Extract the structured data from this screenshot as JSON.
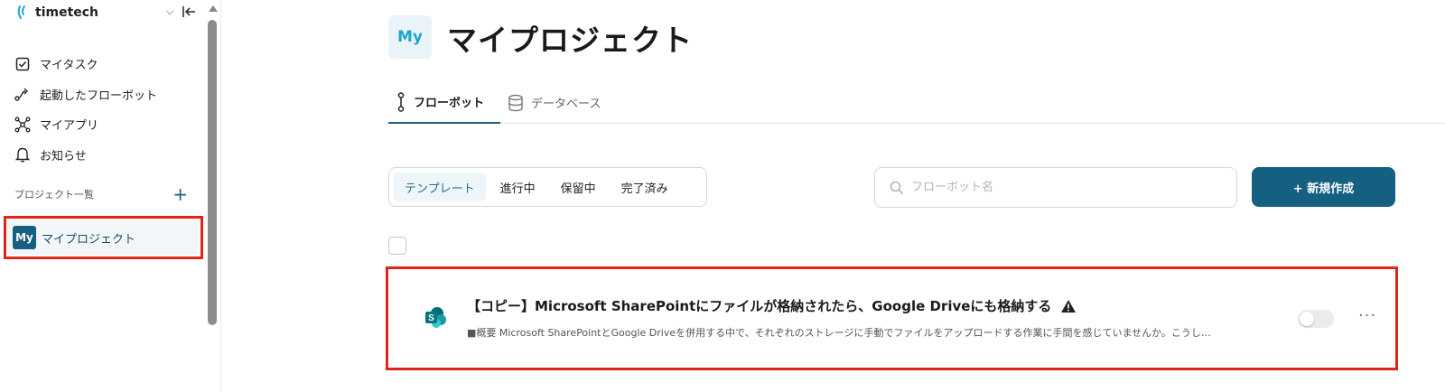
{
  "workspace": {
    "name": "timetech"
  },
  "sidebar": {
    "items": [
      {
        "label": "マイタスク",
        "icon": "checkbox-icon"
      },
      {
        "label": "起動したフローボット",
        "icon": "flow-icon"
      },
      {
        "label": "マイアプリ",
        "icon": "apps-icon"
      },
      {
        "label": "お知らせ",
        "icon": "bell-icon"
      }
    ],
    "projects_heading": "プロジェクト一覧",
    "add_label": "+",
    "project": {
      "badge": "My",
      "label": "マイプロジェクト"
    }
  },
  "page": {
    "badge": "My",
    "title": "マイプロジェクト"
  },
  "tabs": [
    {
      "label": "フローボット",
      "icon": "flowbot-icon",
      "active": true
    },
    {
      "label": "データベース",
      "icon": "database-icon",
      "active": false
    }
  ],
  "filters": [
    {
      "label": "テンプレート",
      "active": true
    },
    {
      "label": "進行中",
      "active": false
    },
    {
      "label": "保留中",
      "active": false
    },
    {
      "label": "完了済み",
      "active": false
    }
  ],
  "search": {
    "placeholder": "フローボット名"
  },
  "new_button": {
    "label": "+ 新規作成"
  },
  "flowbots": [
    {
      "title": "【コピー】Microsoft SharePointにファイルが格納されたら、Google Driveにも格納する",
      "description": "■概要 Microsoft SharePointとGoogle Driveを併用する中で、それぞれのストレージに手動でファイルをアップロードする作業に手間を感じていませんか。こうし…",
      "app_icon": "sharepoint-icon",
      "warning_icon": "warning-icon",
      "enabled": false,
      "more_label": "···"
    }
  ],
  "colors": {
    "accent": "#155f80",
    "highlight": "#e2231a",
    "badge_text": "#1ea6cf"
  }
}
